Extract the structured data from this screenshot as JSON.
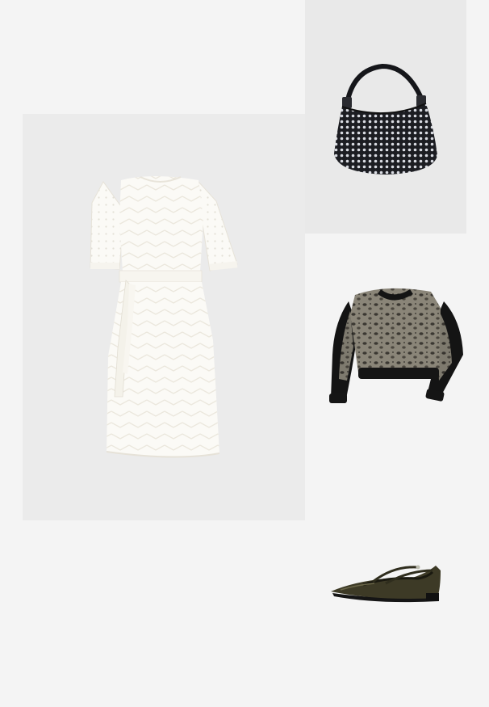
{
  "outfit": {
    "items": [
      {
        "kind": "dress",
        "icon": "white-eyelet-dress",
        "colors": {
          "main": "#fbfaf6",
          "shadow": "#ebe8df"
        }
      },
      {
        "kind": "handbag",
        "icon": "rhinestone-hobo-bag",
        "colors": {
          "main": "#1c1d22",
          "sparkle": "#d9dbe2"
        }
      },
      {
        "kind": "sweatshirt",
        "icon": "leopard-print-sweatshirt",
        "colors": {
          "main": "#7d786c",
          "trim": "#111111"
        }
      },
      {
        "kind": "shoe",
        "icon": "olive-patent-flat",
        "colors": {
          "main": "#3d3a26",
          "sole": "#151515"
        }
      }
    ]
  }
}
